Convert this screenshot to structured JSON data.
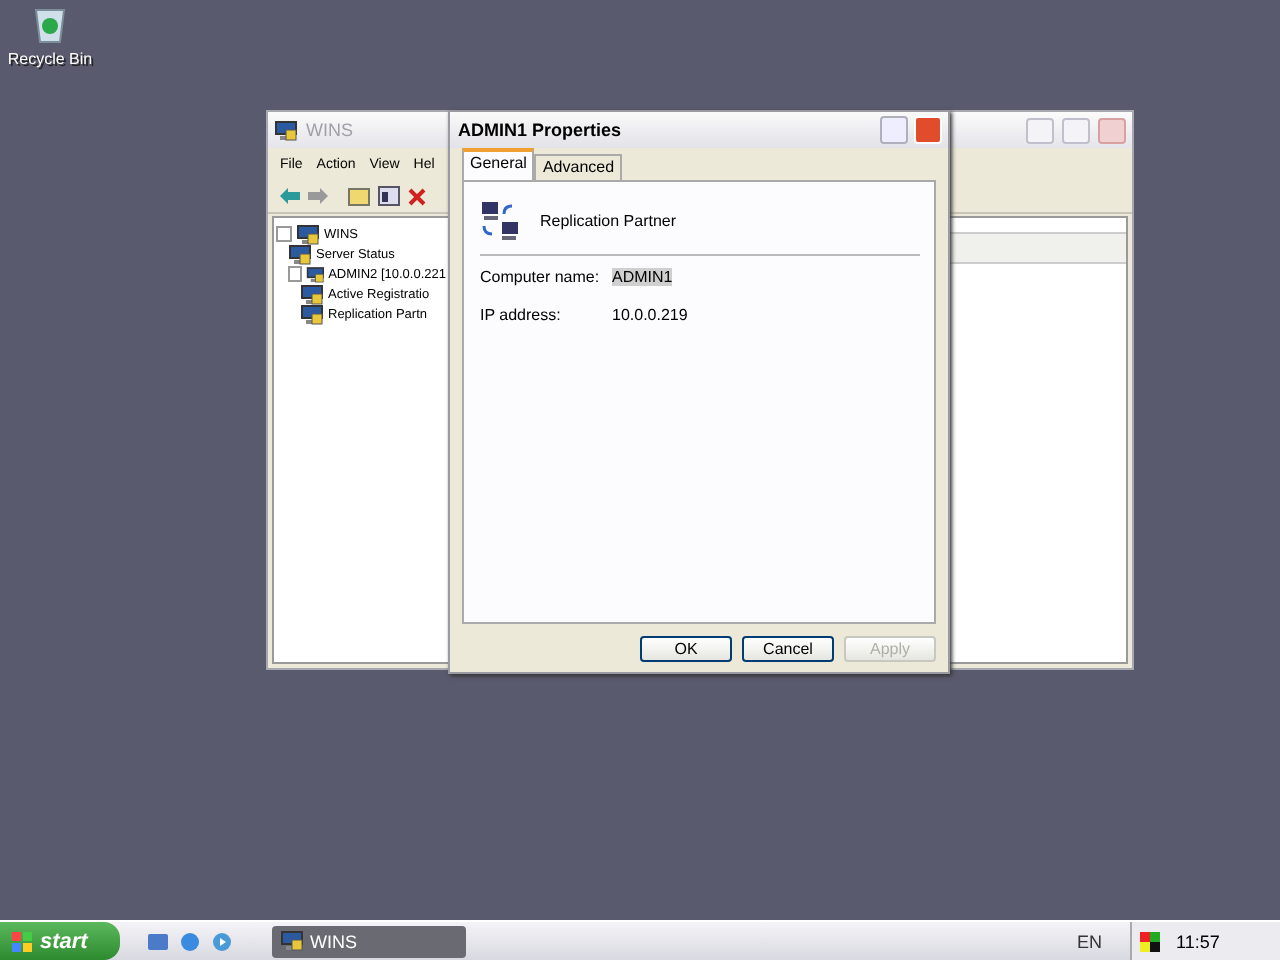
{
  "desktop_icons": [
    {
      "label": "Recycle Bin"
    }
  ],
  "mmc_window": {
    "title": "WINS",
    "active": false,
    "menu": [
      "File",
      "Action",
      "View",
      "Hel"
    ],
    "tree": [
      {
        "label": "WINS",
        "selected": false,
        "expanded": true,
        "children": [
          {
            "label": "Server Status",
            "selected": false
          },
          {
            "label": "ADMIN2 [10.0.0.221",
            "selected": false,
            "expanded": true,
            "children": [
              {
                "label": "Active Registratio",
                "selected": false
              },
              {
                "label": "Replication Partn",
                "selected": false
              }
            ]
          }
        ]
      }
    ]
  },
  "dialog": {
    "title": "ADMIN1 Properties",
    "tabs": [
      {
        "label": "General",
        "selected": true
      },
      {
        "label": "Advanced",
        "selected": false
      }
    ],
    "heading": "Replication Partner",
    "fields": [
      {
        "label": "Computer name:",
        "value": "ADMIN1",
        "highlighted": true
      },
      {
        "label": "IP address:",
        "value": "10.0.0.219",
        "highlighted": false
      }
    ],
    "buttons": [
      {
        "label": "OK",
        "disabled": false
      },
      {
        "label": "Cancel",
        "disabled": false
      },
      {
        "label": "Apply",
        "disabled": true
      }
    ]
  },
  "taskbar": {
    "start": "start",
    "tasks": [
      {
        "label": "WINS",
        "selected": false
      }
    ],
    "language": "EN",
    "clock": "11:57"
  }
}
